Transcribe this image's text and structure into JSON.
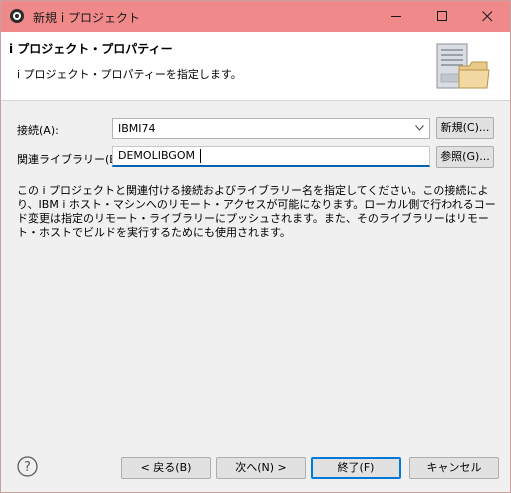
{
  "window": {
    "title": "新規 i プロジェクト"
  },
  "banner": {
    "title": "i プロジェクト・プロパティー",
    "description": "i プロジェクト・プロパティーを指定します。"
  },
  "form": {
    "connection_label": "接続(A):",
    "connection_value": "IBMI74",
    "new_button": "新規(C)...",
    "library_label": "関連ライブラリー(E):",
    "library_value": "DEMOLIBGOM",
    "browse_button": "参照(G)..."
  },
  "description": "この i プロジェクトと関連付ける接続およびライブラリー名を指定してください。この接続により、IBM i ホスト・マシンへのリモート・アクセスが可能になります。ローカル側で行われるコード変更は指定のリモート・ライブラリーにプッシュされます。また、そのライブラリーはリモート・ホストでビルドを実行するためにも使用されます。",
  "footer": {
    "back": "< 戻る(B)",
    "next": "次へ(N) >",
    "finish": "終了(F)",
    "cancel": "キャンセル"
  },
  "colors": {
    "titlebar": "#f08a8a",
    "focus_accent": "#0078d7"
  },
  "icons": [
    "app-icon",
    "minimize-icon",
    "maximize-icon",
    "close-icon",
    "server-folder-icon",
    "chevron-down-icon",
    "help-icon"
  ]
}
